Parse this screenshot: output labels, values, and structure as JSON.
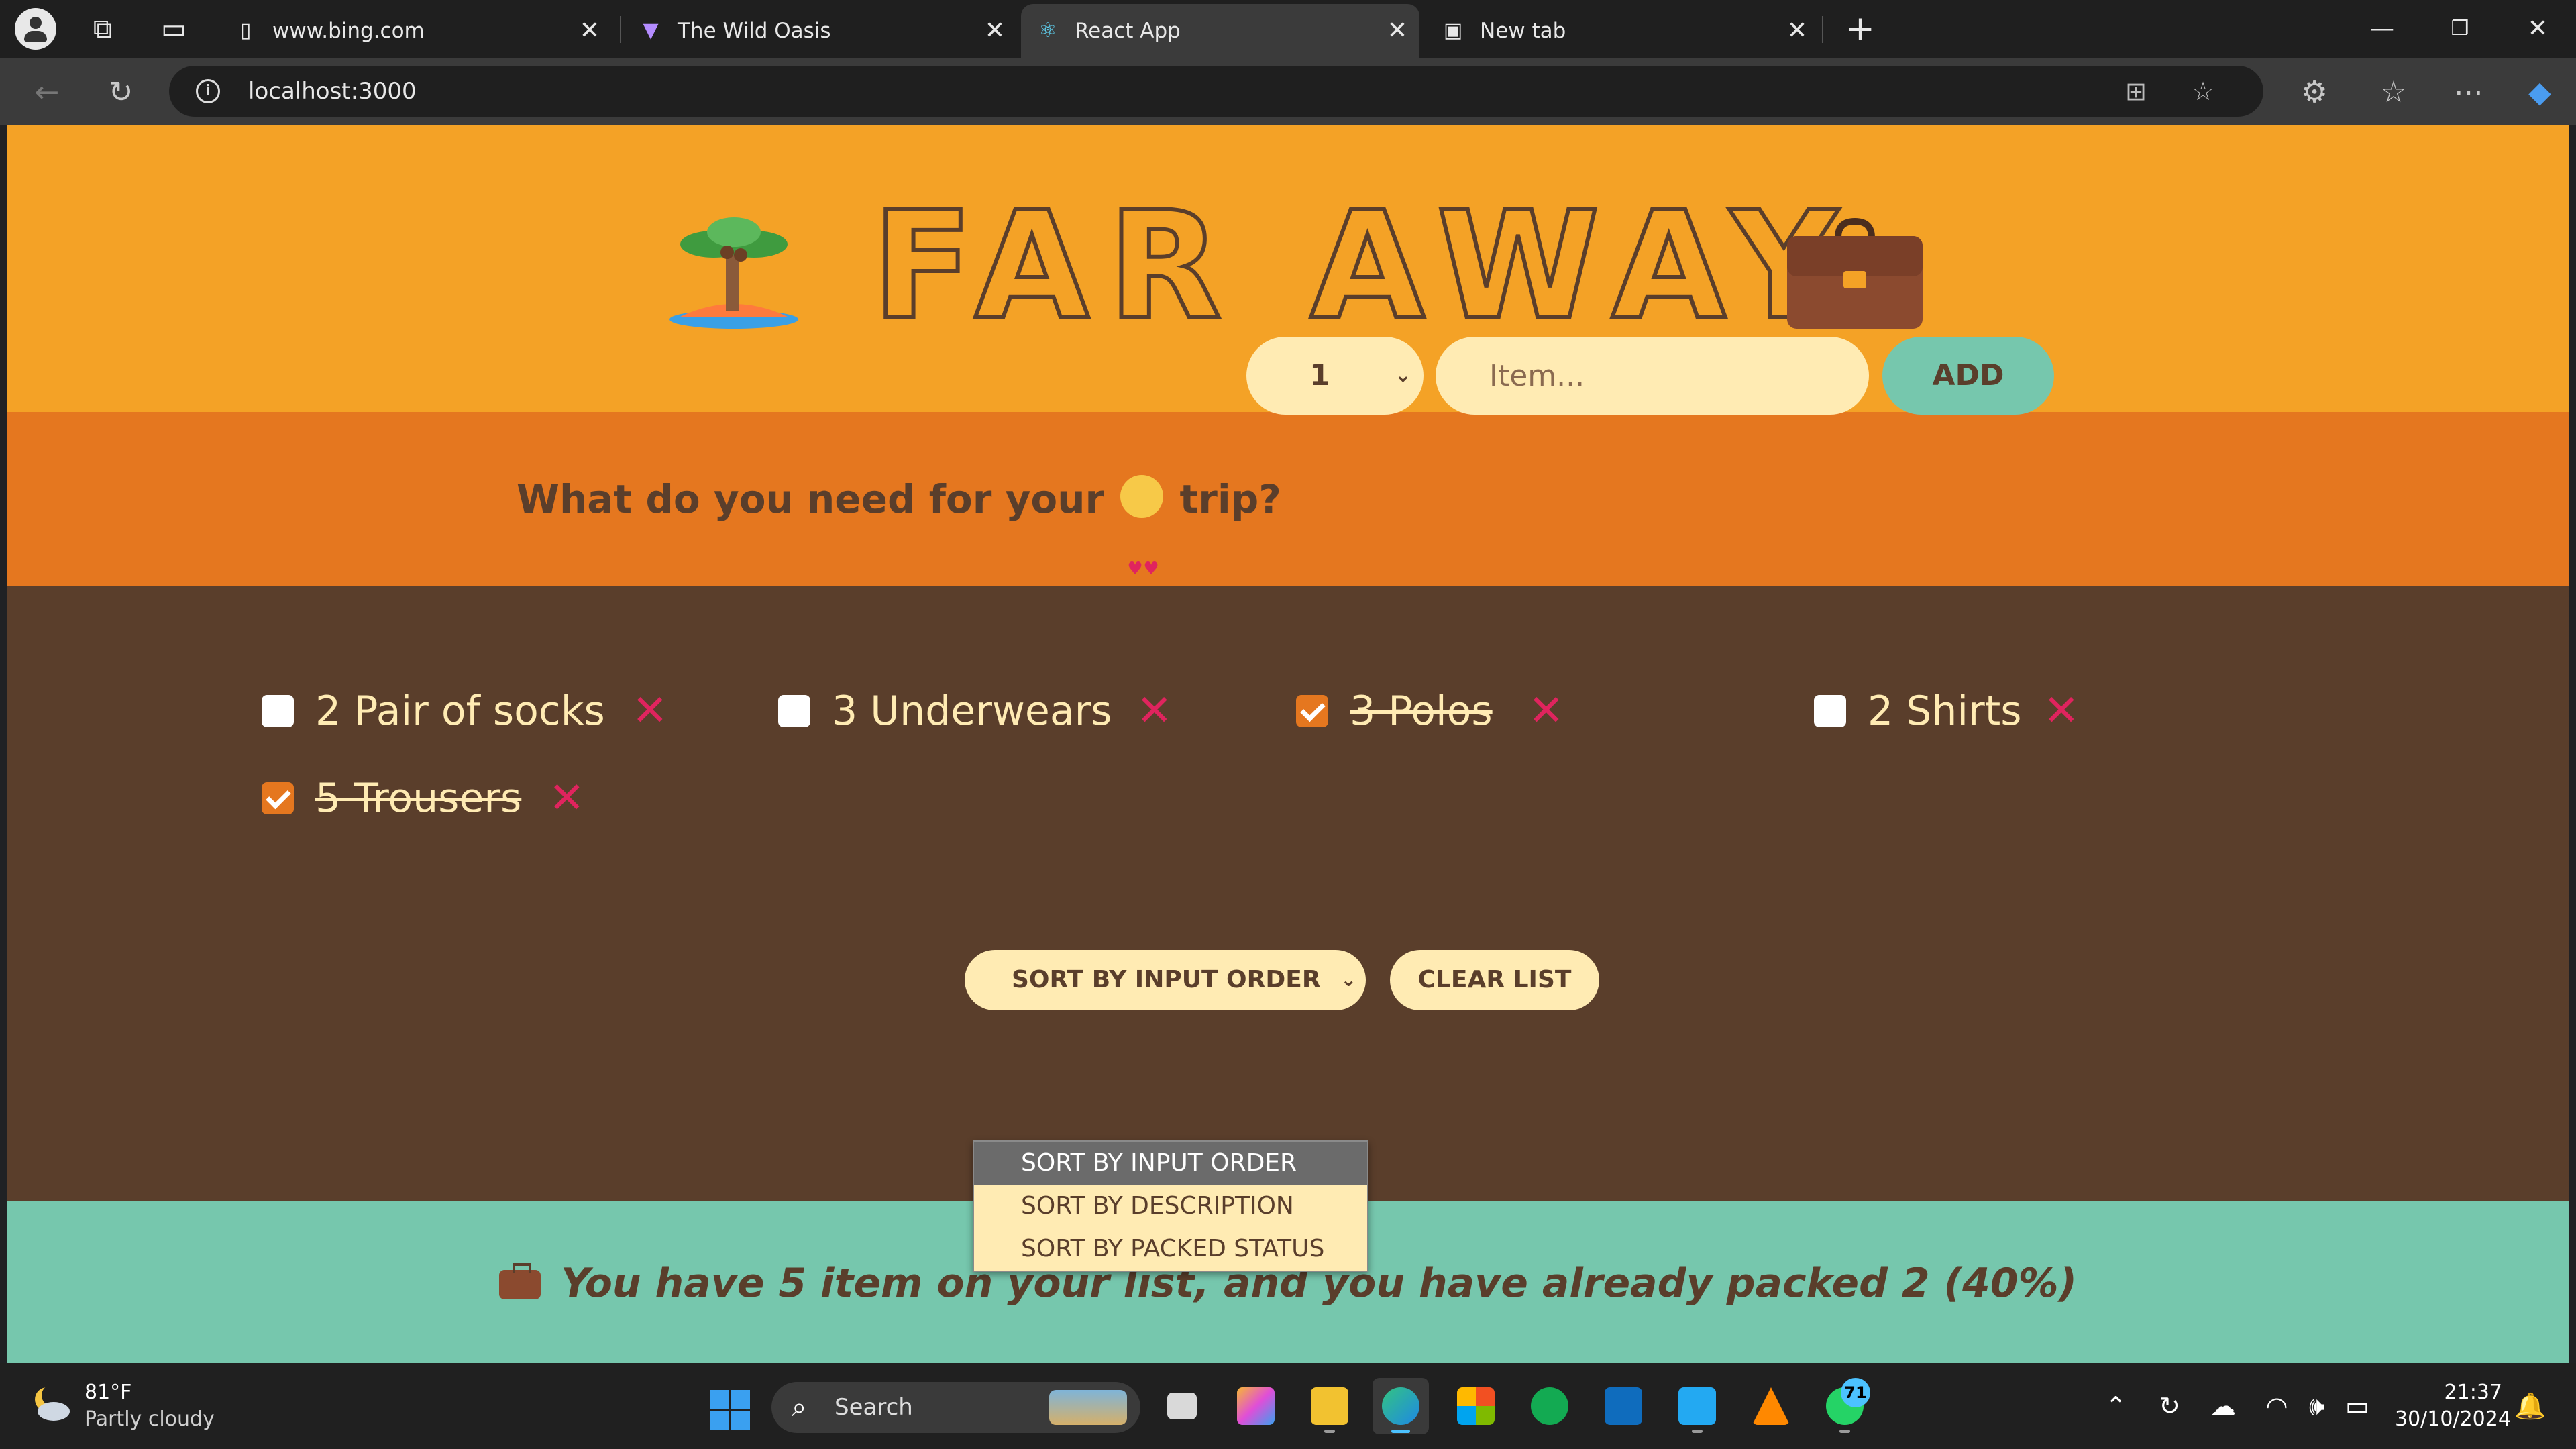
{
  "browser": {
    "tabs": [
      {
        "label": "www.bing.com",
        "active": false
      },
      {
        "label": "The Wild Oasis",
        "active": false
      },
      {
        "label": "React App",
        "active": true
      },
      {
        "label": "New tab",
        "active": false
      }
    ],
    "url": "localhost:3000"
  },
  "app": {
    "logo_text": "FAR AWAY",
    "form": {
      "question_before": "What do you need for your",
      "question_after": "trip?",
      "quantity_value": "1",
      "item_placeholder": "Item...",
      "add_label": "ADD"
    },
    "items": [
      {
        "label": "2 Pair of socks",
        "packed": false
      },
      {
        "label": "3 Underwears",
        "packed": false
      },
      {
        "label": "3 Polos",
        "packed": true
      },
      {
        "label": "2 Shirts",
        "packed": false
      },
      {
        "label": "5 Trousers",
        "packed": true
      }
    ],
    "delete_glyph": "✕",
    "actions": {
      "sort_selected": "SORT BY INPUT ORDER",
      "sort_options": [
        "SORT BY INPUT ORDER",
        "SORT BY DESCRIPTION",
        "SORT BY PACKED STATUS"
      ],
      "clear_label": "CLEAR LIST"
    },
    "stats_text": "You have 5 item on your list, and you have already packed 2 (40%)"
  },
  "taskbar": {
    "weather_temp": "81°F",
    "weather_desc": "Partly cloudy",
    "search_label": "Search",
    "whatsapp_badge": "71",
    "time": "21:37",
    "date": "30/10/2024"
  },
  "colors": {
    "header": "#f4a226",
    "form": "#e5771f",
    "list": "#5a3e2b",
    "stats": "#76c7ad",
    "cream": "#ffebb3",
    "delete": "#e0245e"
  }
}
